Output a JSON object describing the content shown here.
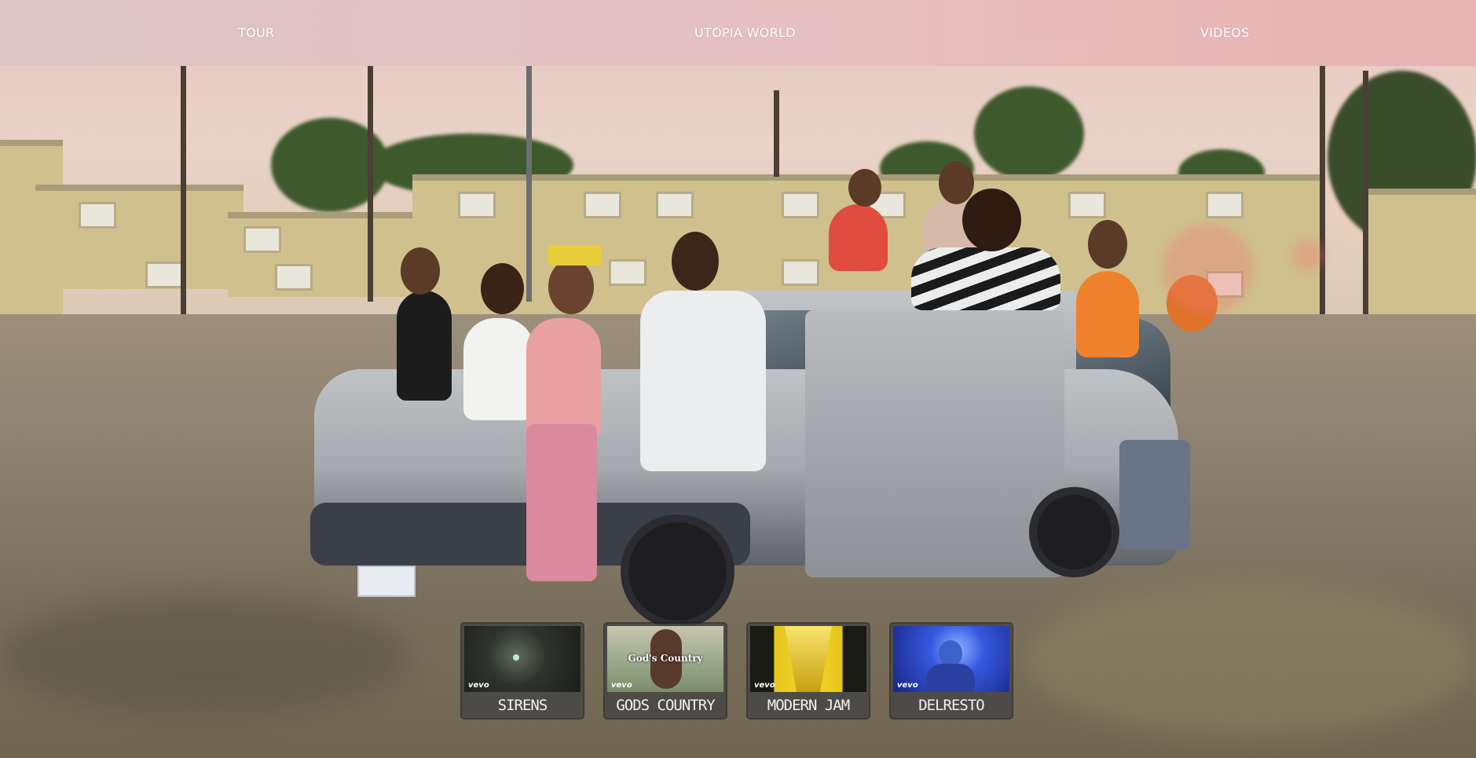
{
  "nav": {
    "links": [
      {
        "label": "TOUR"
      },
      {
        "label": "UTOPIA WORLD"
      },
      {
        "label": "VIDEOS"
      }
    ]
  },
  "hero": {
    "description_icon": "group-photo-car"
  },
  "videos": [
    {
      "label": "SIRENS",
      "badge": "vevo",
      "thumb_color": "#2d302b"
    },
    {
      "label": "GODS COUNTRY",
      "badge": "vevo",
      "thumb_color": "#8a9a7a",
      "thumb_text": "God's Country"
    },
    {
      "label": "MODERN JAM",
      "badge": "vevo",
      "thumb_color": "#e1c21a"
    },
    {
      "label": "DELRESTO",
      "badge": "vevo",
      "thumb_color": "#2b45c8"
    }
  ],
  "colors": {
    "nav_bg": "#e2c0c0",
    "nav_text": "#ffffff",
    "card_bg": "#464646"
  }
}
